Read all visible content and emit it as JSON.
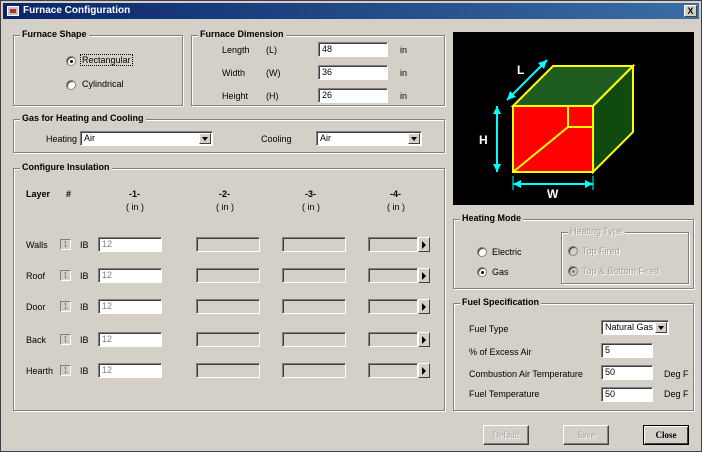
{
  "window": {
    "title": "Furnace Configuration",
    "close": "X"
  },
  "shape": {
    "title": "Furnace Shape",
    "rect_label": "Rectangular",
    "cyl_label": "Cylindrical",
    "selected": "rectangular"
  },
  "dimension": {
    "title": "Furnace Dimension",
    "rows": [
      {
        "label": "Length",
        "sym": "(L)",
        "value": "48",
        "unit": "in"
      },
      {
        "label": "Width",
        "sym": "(W)",
        "value": "36",
        "unit": "in"
      },
      {
        "label": "Height",
        "sym": "(H)",
        "value": "26",
        "unit": "in"
      }
    ]
  },
  "gas": {
    "title": "Gas for Heating and Cooling",
    "heating_label": "Heating",
    "heating_value": "Air",
    "cooling_label": "Cooling",
    "cooling_value": "Air"
  },
  "insulation": {
    "title": "Configure Insulation",
    "layer_header": "Layer",
    "count_header": "#",
    "columns": [
      {
        "num": "-1-",
        "unit": "( in )"
      },
      {
        "num": "-2-",
        "unit": "( in )"
      },
      {
        "num": "-3-",
        "unit": "( in )"
      },
      {
        "num": "-4-",
        "unit": "( in )"
      }
    ],
    "rows": [
      {
        "name": "Walls",
        "count": "1",
        "mat": "IB",
        "thickness": "12"
      },
      {
        "name": "Roof",
        "count": "1",
        "mat": "IB",
        "thickness": "12"
      },
      {
        "name": "Door",
        "count": "1",
        "mat": "IB",
        "thickness": "12"
      },
      {
        "name": "Back",
        "count": "1",
        "mat": "IB",
        "thickness": "12"
      },
      {
        "name": "Hearth",
        "count": "1",
        "mat": "IB",
        "thickness": "12"
      }
    ]
  },
  "diagram": {
    "l": "L",
    "w": "W",
    "h": "H"
  },
  "heating_mode": {
    "title": "Heating Mode",
    "electric": "Electric",
    "gas": "Gas",
    "selected": "gas",
    "type_title": "Heating Type",
    "top_fired": "Top Fired",
    "top_bottom_fired": "Top & Bottom Fired"
  },
  "fuel": {
    "title": "Fuel Specification",
    "type_label": "Fuel Type",
    "type_value": "Natural Gas",
    "excess_label": "% of Excess Air",
    "excess_value": "5",
    "comb_label": "Combustion Air Temperature",
    "comb_value": "50",
    "comb_unit": "Deg F",
    "fuel_temp_label": "Fuel Temperature",
    "fuel_temp_value": "50",
    "fuel_temp_unit": "Deg F"
  },
  "buttons": {
    "default": "Default",
    "save": "Save",
    "close": "Close"
  },
  "colors": {
    "front": "#ff0000",
    "top": "#1f5c1f",
    "side": "#0f4a0f",
    "edge": "#ffff00",
    "arrow": "#00ffff"
  }
}
